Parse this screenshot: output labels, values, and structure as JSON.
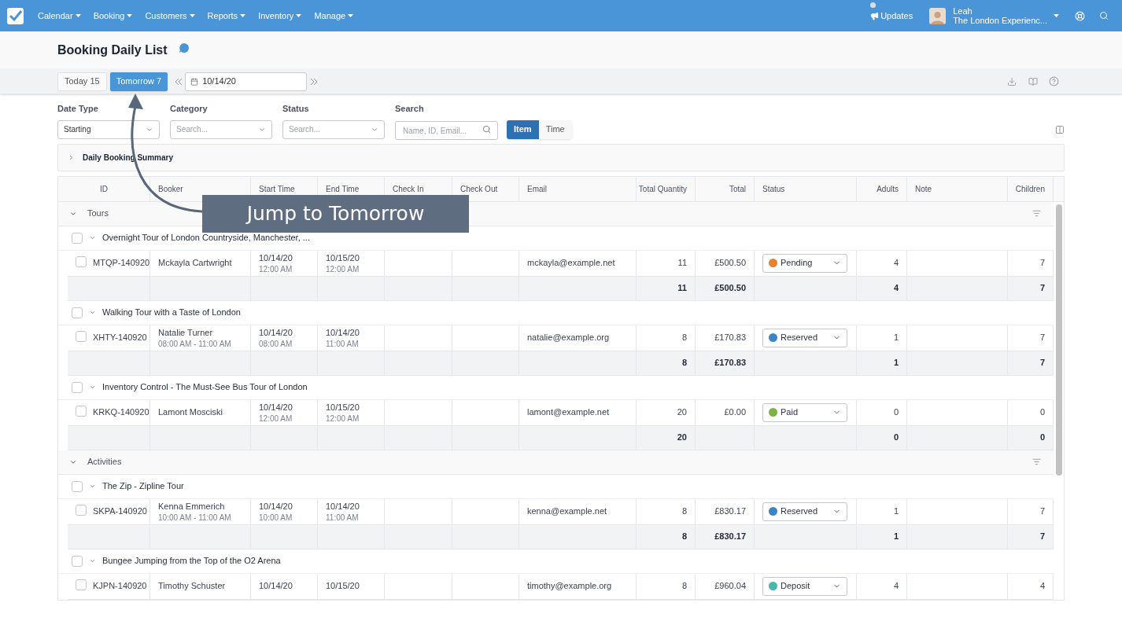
{
  "nav": {
    "menus": [
      "Calendar",
      "Booking",
      "Customers",
      "Reports",
      "Inventory",
      "Manage"
    ],
    "updates": "Updates",
    "user": {
      "name": "Leah",
      "org": "The London Experienc..."
    }
  },
  "page": {
    "title": "Booking Daily List"
  },
  "toolbar": {
    "quick_dates": [
      {
        "label": "Today 15",
        "selected": false
      },
      {
        "label": "Tomorrow 7",
        "selected": true
      }
    ],
    "date": "10/14/20"
  },
  "filters": [
    {
      "label": "Date Type",
      "value": "Starting"
    },
    {
      "label": "Category",
      "placeholder": "Search..."
    },
    {
      "label": "Status",
      "placeholder": "Search..."
    }
  ],
  "search": {
    "label": "Search",
    "placeholder": "Name, ID, Email..."
  },
  "view_toggle": [
    {
      "label": "Item",
      "selected": true
    },
    {
      "label": "Time",
      "selected": false
    }
  ],
  "summary": {
    "title": "Daily Booking Summary",
    "expanded": false
  },
  "table": {
    "columns": [
      "ID",
      "Booker",
      "Start Time",
      "End Time",
      "Check In",
      "Check Out",
      "Email",
      "Total Quantity",
      "Total",
      "Status",
      "Adults",
      "Note",
      "Children"
    ],
    "groups": [
      {
        "name": "Tours",
        "expanded": true,
        "products": [
          {
            "title": "Overnight Tour of London Countryside, Manchester, ...",
            "checked": false,
            "expanded": true,
            "bookings": [
              {
                "checked": false,
                "id": "MTQP-140920",
                "booker": "Mckayla Cartwright",
                "start_date": "10/14/20",
                "start_time": "12:00 AM",
                "end_date": "10/15/20",
                "end_time": "12:00 AM",
                "email": "mckayla@example.net",
                "quantity": "11",
                "total": "£500.50",
                "status": {
                  "label": "Pending",
                  "color": "#e8822e"
                },
                "adults": "4",
                "children": "7"
              }
            ],
            "totals": {
              "quantity": "11",
              "total": "£500.50",
              "adults": "4",
              "children": "7"
            }
          },
          {
            "title": "Walking Tour with a Taste of London",
            "checked": false,
            "expanded": true,
            "bookings": [
              {
                "checked": false,
                "id": "XHTY-140920",
                "booker": "Natalie Turner",
                "time_range": "08:00 AM - 11:00 AM",
                "start_date": "10/14/20",
                "start_time": "08:00 AM",
                "end_date": "10/14/20",
                "end_time": "11:00 AM",
                "email": "natalie@example.org",
                "quantity": "8",
                "total": "£170.83",
                "status": {
                  "label": "Reserved",
                  "color": "#3d85c6"
                },
                "adults": "1",
                "children": "7"
              }
            ],
            "totals": {
              "quantity": "8",
              "total": "£170.83",
              "adults": "1",
              "children": "7"
            }
          },
          {
            "title": "Inventory Control - The Must-See Bus Tour of London",
            "checked": false,
            "expanded": true,
            "bookings": [
              {
                "checked": false,
                "id": "KRKQ-140920",
                "booker": "Lamont Mosciski",
                "start_date": "10/14/20",
                "start_time": "12:00 AM",
                "end_date": "10/15/20",
                "end_time": "12:00 AM",
                "email": "lamont@example.net",
                "quantity": "20",
                "total": "£0.00",
                "status": {
                  "label": "Paid",
                  "color": "#7cb342"
                },
                "adults": "0",
                "children": "0"
              }
            ],
            "totals": {
              "quantity": "20",
              "adults": "0",
              "children": "0"
            }
          }
        ]
      },
      {
        "name": "Activities",
        "expanded": true,
        "products": [
          {
            "title": "The Zip - Zipline Tour",
            "checked": false,
            "expanded": true,
            "bookings": [
              {
                "checked": false,
                "id": "SKPA-140920",
                "booker": "Kenna Emmerich",
                "time_range": "10:00 AM - 11:00 AM",
                "start_date": "10/14/20",
                "start_time": "10:00 AM",
                "end_date": "10/14/20",
                "end_time": "11:00 AM",
                "email": "kenna@example.net",
                "quantity": "8",
                "total": "£830.17",
                "status": {
                  "label": "Reserved",
                  "color": "#3d85c6"
                },
                "adults": "1",
                "children": "7"
              }
            ],
            "totals": {
              "quantity": "8",
              "total": "£830.17",
              "adults": "1",
              "children": "7"
            }
          },
          {
            "title": "Bungee Jumping from the Top of the O2 Arena",
            "checked": false,
            "expanded": true,
            "bookings": [
              {
                "checked": false,
                "id": "KJPN-140920",
                "booker": "Timothy Schuster",
                "start_date": "10/14/20",
                "end_date": "10/15/20",
                "email": "timothy@example.org",
                "quantity": "8",
                "total": "£960.04",
                "status": {
                  "label": "Deposit",
                  "color": "#4db6ac"
                },
                "adults": "4",
                "children": "4"
              }
            ]
          }
        ]
      }
    ]
  },
  "callout": {
    "text": "Jump to Tomorrow"
  }
}
